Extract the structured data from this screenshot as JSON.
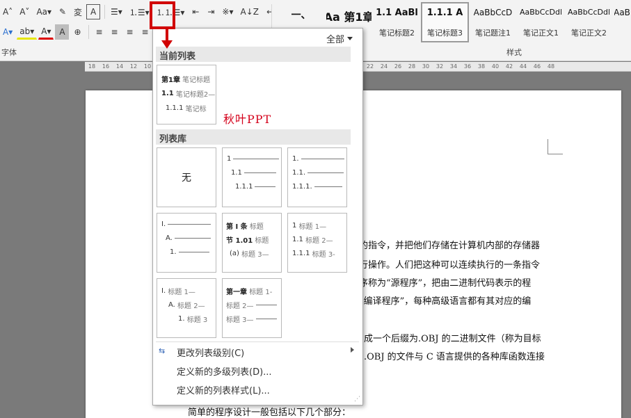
{
  "ribbon": {
    "row1": [
      "A˄",
      "A˅",
      "Aa▾",
      "✎",
      "変",
      "A",
      "☰▾",
      "⒈☰▾",
      "⒈⒈☰▾",
      "⇤",
      "⇥",
      "※▾",
      "A↓Z",
      "↵"
    ],
    "row2": [
      "A▾",
      "ab▾",
      "A▾",
      "A",
      "⊕",
      "≡",
      "≡",
      "≡",
      "≡",
      "≡",
      "↕▾",
      "▦▾",
      "⊞▾"
    ],
    "font_group_label": "字体",
    "styles_group_label": "样式",
    "styles": [
      {
        "preview": "一、",
        "name": ""
      },
      {
        "preview": "Aa 第1章",
        "name": ""
      },
      {
        "preview": "1.1 AaBl",
        "name": "笔记标题2"
      },
      {
        "preview": "1.1.1 A",
        "name": "笔记标题3"
      },
      {
        "preview": "AaBbCcD",
        "name": "笔记题注1"
      },
      {
        "preview": "AaBbCcDdl",
        "name": "笔记正文1"
      },
      {
        "preview": "AaBbCcDdl",
        "name": "笔记正文2"
      },
      {
        "preview": "AaB",
        "name": ""
      }
    ]
  },
  "ruler": {
    "ticks": [
      "18",
      "16",
      "14",
      "12",
      "10",
      "8",
      "6",
      "4",
      "2",
      "",
      "2",
      "4",
      "6",
      "8",
      "10",
      "12",
      "14",
      "16",
      "18",
      "20",
      "22",
      "24",
      "26",
      "28",
      "30",
      "32",
      "34",
      "36",
      "38",
      "40",
      "42",
      "44",
      "46",
      "48"
    ]
  },
  "dropdown": {
    "filter": "全部",
    "current_section": "当前列表",
    "library_section": "列表库",
    "current_tile": {
      "lines": [
        {
          "num": "第1章",
          "label": "笔记标题"
        },
        {
          "num": "1.1",
          "label": "笔记标题2—"
        },
        {
          "num": "1.1.1",
          "label": "笔记标"
        }
      ]
    },
    "watermark": "秋叶PPT",
    "tiles": [
      {
        "none": "无"
      },
      {
        "lines": [
          {
            "num": "1"
          },
          {
            "num": "1.1"
          },
          {
            "num": "1.1.1"
          }
        ]
      },
      {
        "lines": [
          {
            "num": "1."
          },
          {
            "num": "1.1."
          },
          {
            "num": "1.1.1."
          }
        ]
      },
      {
        "lines": [
          {
            "num": "I."
          },
          {
            "num": "A."
          },
          {
            "num": "1."
          }
        ]
      },
      {
        "lines": [
          {
            "num": "第 Ⅰ 条",
            "label": "标题"
          },
          {
            "num": "节 1.01",
            "label": "标题"
          },
          {
            "num": "(a)",
            "label": "标题 3—"
          }
        ]
      },
      {
        "lines": [
          {
            "num": "1",
            "label": "标题 1—"
          },
          {
            "num": "1.1",
            "label": "标题 2—"
          },
          {
            "num": "1.1.1",
            "label": "标题 3-"
          }
        ]
      },
      {
        "lines": [
          {
            "num": "I.",
            "label": "标题 1—"
          },
          {
            "num": "A.",
            "label": "标题 2—"
          },
          {
            "num": "1.",
            "label": "标题 3"
          }
        ]
      },
      {
        "lines": [
          {
            "num": "第一章",
            "label": "标题 1-"
          },
          {
            "label": "标题 2—"
          },
          {
            "label": "标题 3—"
          }
        ]
      }
    ],
    "commands": [
      "更改列表级别(C)",
      "定义新的多级列表(D)...",
      "定义新的列表样式(L)..."
    ]
  },
  "document": {
    "lines": [
      "的指令，并把他们存储在计算机内部的存储器",
      "行操作。人们把这种可以连续执行的一条指令",
      "序称为“源程序”，把由二进制代码表示的程",
      "“编译程序”，每种高级语言都有其对应的编",
      "成一个后缀为.OBJ 的二进制文件（称为目标",
      ".OBJ 的文件与 C 语言提供的各种库函数连接",
      "简单的程序设计一般包括以下几个部分："
    ]
  }
}
